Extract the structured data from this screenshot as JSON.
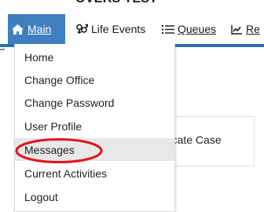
{
  "app": {
    "title_fragment": "OVERS TEST"
  },
  "navbar": {
    "items": [
      {
        "label": "Main",
        "icon": "home-icon"
      },
      {
        "label": "Life Events",
        "icon": "life-events-icon"
      },
      {
        "label": "Queues",
        "icon": "list-icon"
      },
      {
        "label": "Re",
        "icon": "chart-icon"
      }
    ]
  },
  "dropdown": {
    "items": [
      {
        "label": "Home"
      },
      {
        "label": "Change Office"
      },
      {
        "label": "Change Password"
      },
      {
        "label": "User Profile"
      },
      {
        "label": "Messages"
      },
      {
        "label": "Current Activities"
      },
      {
        "label": "Logout"
      }
    ],
    "hovered_item": "Messages"
  },
  "card": {
    "label": "Locate Case"
  },
  "colors": {
    "nav_active": "#3f7fbf",
    "rule": "#2f6fae",
    "annotation": "#e0141e",
    "hover": "#e8e8e8"
  }
}
